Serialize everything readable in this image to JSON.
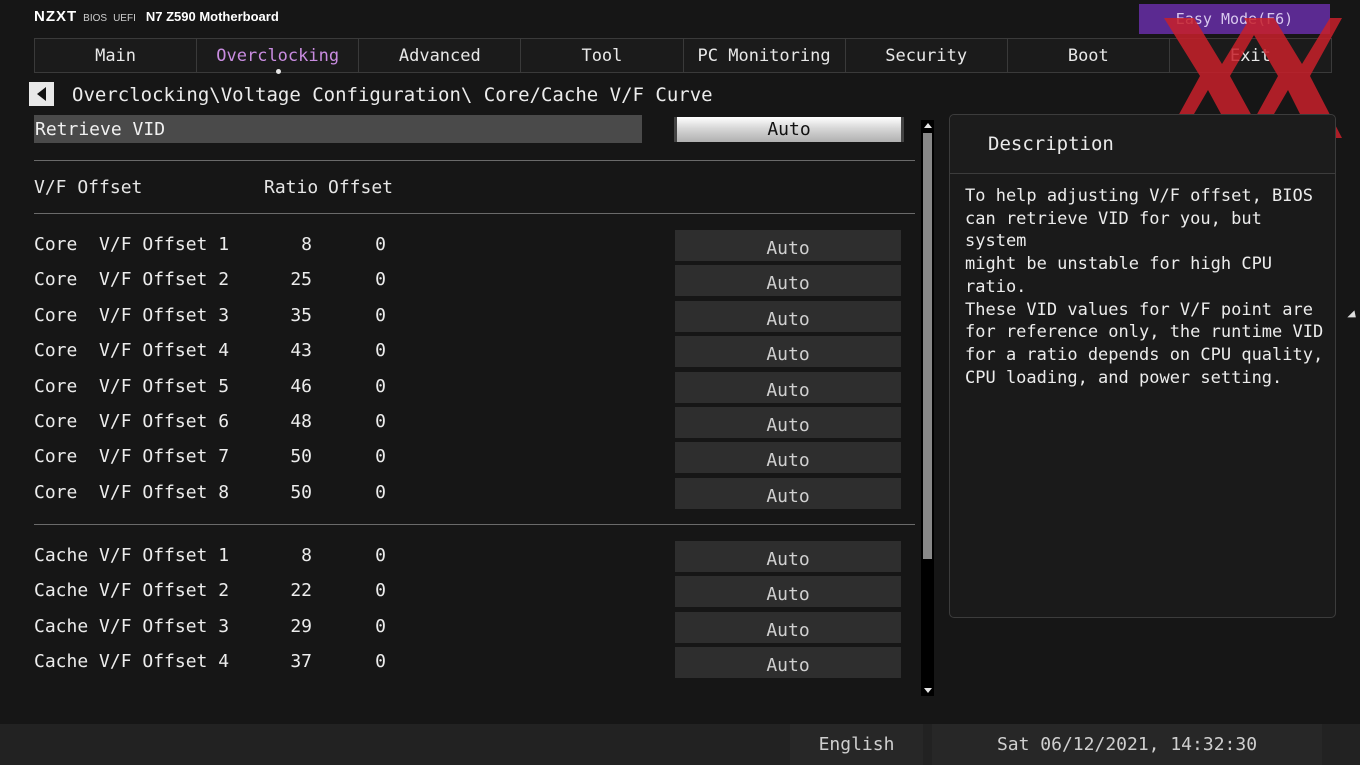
{
  "brand": {
    "logo": "NZXT",
    "bios": "BIOS",
    "uefi": "UEFI",
    "model": "N7 Z590 Motherboard"
  },
  "easy_mode_label": "Easy Mode(F6)",
  "tabs": [
    {
      "label": "Main",
      "active": false
    },
    {
      "label": "Overclocking",
      "active": true
    },
    {
      "label": "Advanced",
      "active": false
    },
    {
      "label": "Tool",
      "active": false
    },
    {
      "label": "PC Monitoring",
      "active": false
    },
    {
      "label": "Security",
      "active": false
    },
    {
      "label": "Boot",
      "active": false
    },
    {
      "label": "Exit",
      "active": false
    }
  ],
  "breadcrumb": "Overclocking\\Voltage Configuration\\ Core/Cache V/F Curve",
  "retrieve_vid": {
    "label": "Retrieve VID",
    "value": "Auto"
  },
  "table_header": {
    "name": "V/F Offset",
    "ratio": "Ratio",
    "offset": "Offset"
  },
  "core_rows": [
    {
      "name": "Core  V/F Offset 1",
      "ratio": "8",
      "offset": "0",
      "value": "Auto"
    },
    {
      "name": "Core  V/F Offset 2",
      "ratio": "25",
      "offset": "0",
      "value": "Auto"
    },
    {
      "name": "Core  V/F Offset 3",
      "ratio": "35",
      "offset": "0",
      "value": "Auto"
    },
    {
      "name": "Core  V/F Offset 4",
      "ratio": "43",
      "offset": "0",
      "value": "Auto"
    },
    {
      "name": "Core  V/F Offset 5",
      "ratio": "46",
      "offset": "0",
      "value": "Auto"
    },
    {
      "name": "Core  V/F Offset 6",
      "ratio": "48",
      "offset": "0",
      "value": "Auto"
    },
    {
      "name": "Core  V/F Offset 7",
      "ratio": "50",
      "offset": "0",
      "value": "Auto"
    },
    {
      "name": "Core  V/F Offset 8",
      "ratio": "50",
      "offset": "0",
      "value": "Auto"
    }
  ],
  "cache_rows": [
    {
      "name": "Cache V/F Offset 1",
      "ratio": "8",
      "offset": "0",
      "value": "Auto"
    },
    {
      "name": "Cache V/F Offset 2",
      "ratio": "22",
      "offset": "0",
      "value": "Auto"
    },
    {
      "name": "Cache V/F Offset 3",
      "ratio": "29",
      "offset": "0",
      "value": "Auto"
    },
    {
      "name": "Cache V/F Offset 4",
      "ratio": "37",
      "offset": "0",
      "value": "Auto"
    }
  ],
  "description": {
    "title": "Description",
    "text": "To help adjusting V/F offset, BIOS\ncan retrieve VID for you, but system\nmight be unstable for high CPU ratio.\nThese VID values for V/F point are\nfor reference only, the runtime VID\nfor a ratio depends on CPU quality,\nCPU loading, and power setting."
  },
  "footer": {
    "language": "English",
    "datetime": "Sat 06/12/2021, 14:32:30"
  },
  "colors": {
    "accent": "#c98ce0",
    "easy_mode_bg": "#5b2a91",
    "watermark": "#c8202a",
    "background": "#161616"
  },
  "icons": {
    "back": "back-arrow-icon",
    "scroll_up": "scroll-up-icon",
    "scroll_down": "scroll-down-icon",
    "watermark": "xx-logo"
  }
}
